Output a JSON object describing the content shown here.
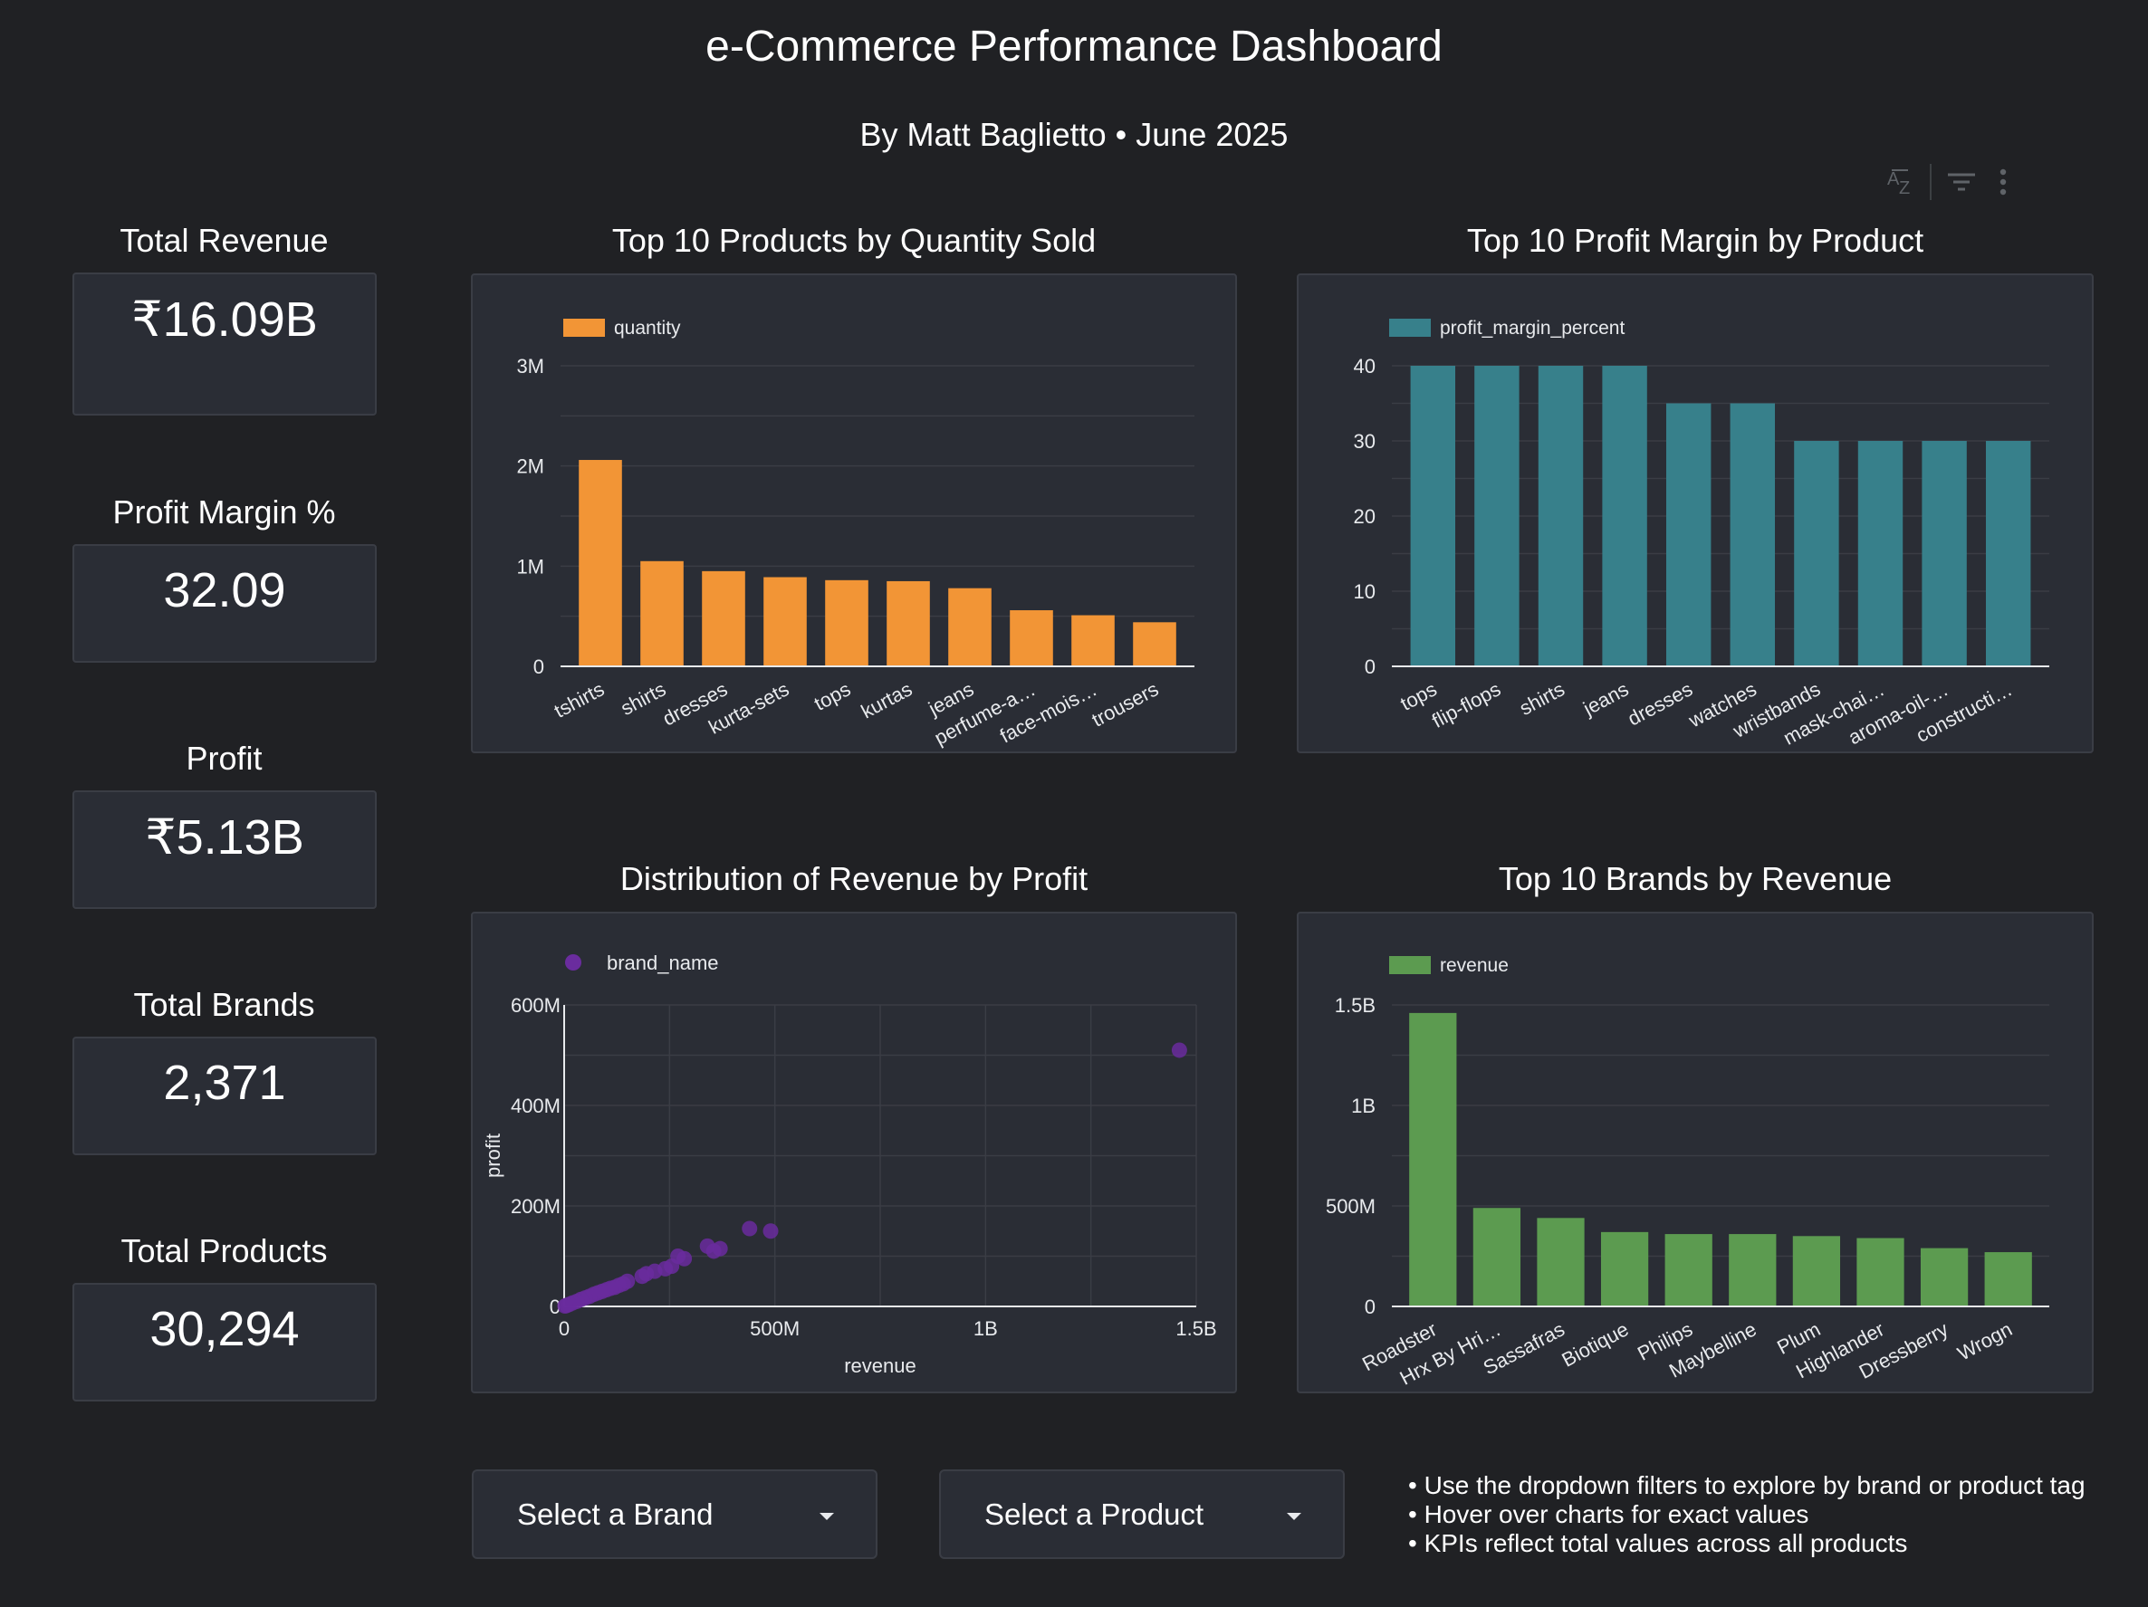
{
  "header": {
    "title": "e-Commerce Performance Dashboard",
    "subtitle": "By Matt Baglietto  •  June 2025"
  },
  "toolbar": {
    "sort_icon": "sort-az-icon",
    "filter_icon": "filter-icon",
    "more_icon": "more-vert-icon"
  },
  "kpis": [
    {
      "label": "Total Revenue",
      "value": "₹16.09B"
    },
    {
      "label": "Profit Margin %",
      "value": "32.09"
    },
    {
      "label": "Profit",
      "value": "₹5.13B"
    },
    {
      "label": "Total Brands",
      "value": "2,371"
    },
    {
      "label": "Total Products",
      "value": "30,294"
    }
  ],
  "charts": {
    "quantity_title": "Top 10 Products by Quantity Sold",
    "margin_title": "Top 10 Profit Margin by Product",
    "scatter_title": "Distribution of Revenue by Profit",
    "brands_title": "Top 10 Brands by Revenue"
  },
  "filters": {
    "brand": "Select a Brand",
    "product": "Select a Product"
  },
  "notes": [
    "• Use the dropdown filters to explore by brand or product tag",
    "• Hover over charts for exact values",
    "• KPIs reflect total values across all products"
  ],
  "colors": {
    "quantity": "#f29536",
    "margin": "#37808b",
    "scatter": "#6a2c9e",
    "brands": "#5c9b50",
    "grid": "#3a3d45",
    "axis": "#e8eaed"
  },
  "chart_data": [
    {
      "type": "bar",
      "title": "Top 10 Products by Quantity Sold",
      "legend": "quantity",
      "categories": [
        "tshirts",
        "shirts",
        "dresses",
        "kurta-sets",
        "tops",
        "kurtas",
        "jeans",
        "perfume-a…",
        "face-mois…",
        "trousers"
      ],
      "values": [
        2060000,
        1050000,
        950000,
        890000,
        860000,
        850000,
        780000,
        560000,
        510000,
        440000
      ],
      "ylim": [
        0,
        3000000
      ],
      "yticks": [
        {
          "v": 0,
          "label": "0"
        },
        {
          "v": 1000000,
          "label": "1M"
        },
        {
          "v": 2000000,
          "label": "2M"
        },
        {
          "v": 3000000,
          "label": "3M"
        }
      ],
      "grid_step": 500000,
      "legend_position": "top-left"
    },
    {
      "type": "bar",
      "title": "Top 10 Profit Margin by Product",
      "legend": "profit_margin_percent",
      "categories": [
        "tops",
        "flip-flops",
        "shirts",
        "jeans",
        "dresses",
        "watches",
        "wristbands",
        "mask-chai…",
        "aroma-oil-…",
        "constructi…"
      ],
      "values": [
        40,
        40,
        40,
        40,
        35,
        35,
        30,
        30,
        30,
        30
      ],
      "ylim": [
        0,
        40
      ],
      "yticks": [
        {
          "v": 0,
          "label": "0"
        },
        {
          "v": 10,
          "label": "10"
        },
        {
          "v": 20,
          "label": "20"
        },
        {
          "v": 30,
          "label": "30"
        },
        {
          "v": 40,
          "label": "40"
        }
      ],
      "grid_step": 5,
      "legend_position": "top-left"
    },
    {
      "type": "scatter",
      "title": "Distribution of Revenue by Profit",
      "legend": "brand_name",
      "xlabel": "revenue",
      "ylabel": "profit",
      "xlim": [
        0,
        1500000000
      ],
      "ylim": [
        0,
        600000000
      ],
      "xticks": [
        {
          "v": 0,
          "label": "0"
        },
        {
          "v": 500000000,
          "label": "500M"
        },
        {
          "v": 1000000000,
          "label": "1B"
        },
        {
          "v": 1500000000,
          "label": "1.5B"
        }
      ],
      "yticks": [
        {
          "v": 0,
          "label": "0"
        },
        {
          "v": 200000000,
          "label": "200M"
        },
        {
          "v": 400000000,
          "label": "400M"
        },
        {
          "v": 600000000,
          "label": "600M"
        }
      ],
      "points": [
        [
          1460000000,
          510000000
        ],
        [
          490000000,
          150000000
        ],
        [
          440000000,
          155000000
        ],
        [
          370000000,
          115000000
        ],
        [
          355000000,
          110000000
        ],
        [
          340000000,
          120000000
        ],
        [
          285000000,
          95000000
        ],
        [
          270000000,
          100000000
        ],
        [
          255000000,
          80000000
        ],
        [
          240000000,
          75000000
        ],
        [
          215000000,
          70000000
        ],
        [
          195000000,
          65000000
        ],
        [
          185000000,
          60000000
        ],
        [
          150000000,
          50000000
        ],
        [
          140000000,
          45000000
        ],
        [
          130000000,
          42000000
        ],
        [
          120000000,
          38000000
        ],
        [
          110000000,
          36000000
        ],
        [
          100000000,
          33000000
        ],
        [
          90000000,
          30000000
        ],
        [
          80000000,
          27000000
        ],
        [
          70000000,
          24000000
        ],
        [
          60000000,
          20000000
        ],
        [
          50000000,
          17000000
        ],
        [
          40000000,
          14000000
        ],
        [
          30000000,
          10000000
        ],
        [
          20000000,
          7000000
        ],
        [
          12000000,
          4000000
        ],
        [
          6000000,
          2000000
        ],
        [
          2000000,
          800000
        ]
      ],
      "grid": true,
      "legend_position": "top-left"
    },
    {
      "type": "bar",
      "title": "Top 10 Brands by Revenue",
      "legend": "revenue",
      "categories": [
        "Roadster",
        "Hrx By Hri…",
        "Sassafras",
        "Biotique",
        "Philips",
        "Maybelline",
        "Plum",
        "Highlander",
        "Dressberry",
        "Wrogn"
      ],
      "values": [
        1460000000,
        490000000,
        440000000,
        370000000,
        360000000,
        360000000,
        350000000,
        340000000,
        290000000,
        270000000
      ],
      "ylim": [
        0,
        1500000000
      ],
      "yticks": [
        {
          "v": 0,
          "label": "0"
        },
        {
          "v": 500000000,
          "label": "500M"
        },
        {
          "v": 1000000000,
          "label": "1B"
        },
        {
          "v": 1500000000,
          "label": "1.5B"
        }
      ],
      "grid_step": 250000000,
      "legend_position": "top-left"
    }
  ]
}
